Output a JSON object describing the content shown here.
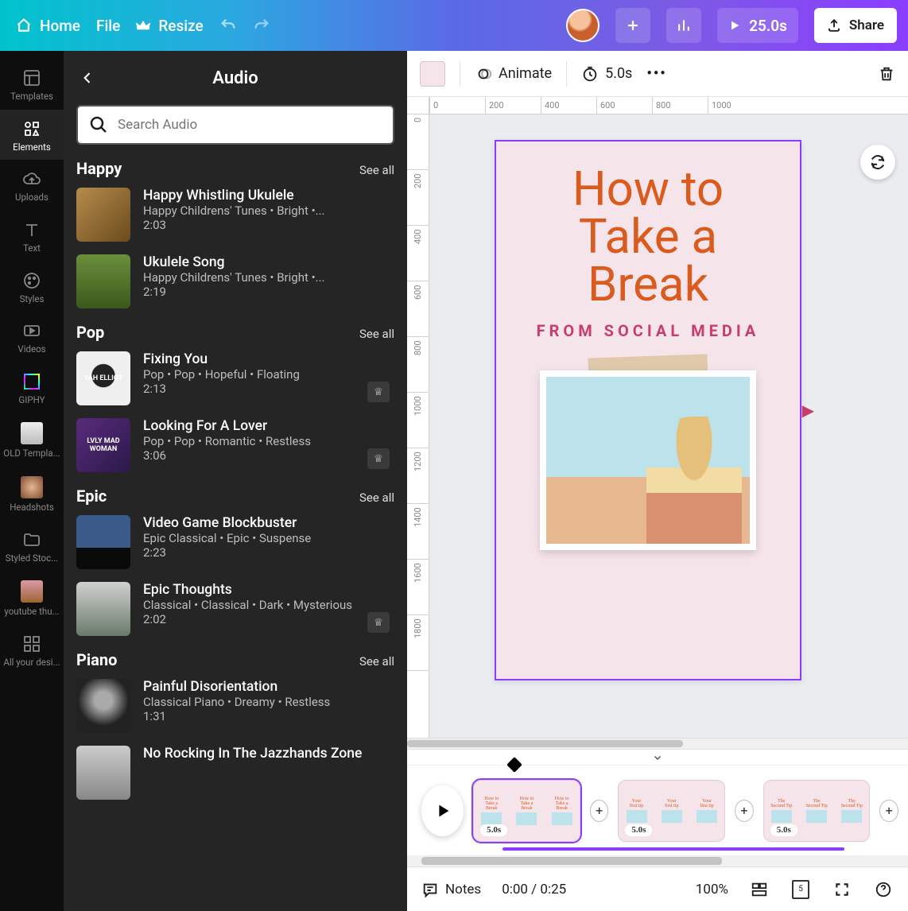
{
  "topbar": {
    "home": "Home",
    "file": "File",
    "resize": "Resize",
    "duration": "25.0s",
    "share": "Share"
  },
  "sidebar": {
    "items": [
      {
        "label": "Templates"
      },
      {
        "label": "Elements"
      },
      {
        "label": "Uploads"
      },
      {
        "label": "Text"
      },
      {
        "label": "Styles"
      },
      {
        "label": "Videos"
      },
      {
        "label": "GIPHY"
      },
      {
        "label": "OLD Templa..."
      },
      {
        "label": "Headshots"
      },
      {
        "label": "Styled Stoc..."
      },
      {
        "label": "youtube thu..."
      },
      {
        "label": "All your desi..."
      }
    ]
  },
  "panel": {
    "title": "Audio",
    "search_placeholder": "Search Audio",
    "sections": [
      {
        "name": "Happy",
        "see_all": "See all",
        "tracks": [
          {
            "title": "Happy Whistling Ukulele",
            "tags": "Happy Childrens' Tunes • Bright •...",
            "dur": "2:03",
            "art_bg": "linear-gradient(135deg,#b58c4a,#6b4a1e)"
          },
          {
            "title": "Ukulele Song",
            "tags": "Happy Childrens' Tunes • Bright •...",
            "dur": "2:19",
            "art_bg": "linear-gradient(180deg,#6a8f3a,#3a5a1e)"
          }
        ]
      },
      {
        "name": "Pop",
        "see_all": "See all",
        "tracks": [
          {
            "title": "Fixing You",
            "tags": "Pop • Pop • Hopeful • Floating",
            "dur": "2:13",
            "crown": true,
            "art_bg": "radial-gradient(circle at 50% 45%, #222 0 28%, #efefef 30% 100%)",
            "art_text": "YAH ELLIOT"
          },
          {
            "title": "Looking For A Lover",
            "tags": "Pop • Pop • Romantic • Restless",
            "dur": "3:06",
            "crown": true,
            "art_bg": "linear-gradient(135deg,#5a2a7a,#2a1a4a)",
            "art_text": "LVLY MAD WOMAN"
          }
        ]
      },
      {
        "name": "Epic",
        "see_all": "See all",
        "tracks": [
          {
            "title": "Video Game Blockbuster",
            "tags": "Epic Classical • Epic • Suspense",
            "dur": "2:23",
            "art_bg": "linear-gradient(180deg,#3a5a8a 0 60%,#0a0a0a 60% 100%)"
          },
          {
            "title": "Epic Thoughts",
            "tags": "Classical • Classical • Dark • Mysterious",
            "dur": "2:02",
            "crown": true,
            "art_bg": "linear-gradient(180deg,#d0d0d0,#6a7a6a)"
          }
        ]
      },
      {
        "name": "Piano",
        "see_all": "See all",
        "tracks": [
          {
            "title": "Painful Disorientation",
            "tags": "Classical Piano • Dreamy • Restless",
            "dur": "1:31",
            "art_bg": "radial-gradient(circle at 50% 40%, #aaa 0 20%, #222 60%)"
          },
          {
            "title": "No Rocking In The Jazzhands Zone",
            "tags": "",
            "dur": "",
            "art_bg": "linear-gradient(180deg,#ccc,#888)"
          }
        ]
      }
    ]
  },
  "toolrow": {
    "animate": "Animate",
    "page_dur": "5.0s"
  },
  "ruler_top": [
    "0",
    "200",
    "400",
    "600",
    "800",
    "1000"
  ],
  "ruler_left": [
    "0",
    "200",
    "400",
    "600",
    "800",
    "1000",
    "1200",
    "1400",
    "1600",
    "1800"
  ],
  "stage": {
    "title_lines": [
      "How to",
      "Take a",
      "Break"
    ],
    "subtitle": "FROM SOCIAL MEDIA"
  },
  "timeline": {
    "scenes": [
      {
        "badge": "5.0s",
        "selected": true,
        "lines": [
          "How to",
          "Take a",
          "Break"
        ]
      },
      {
        "badge": "5.0s",
        "selected": false,
        "lines": [
          "Your",
          "first tip"
        ]
      },
      {
        "badge": "5.0s",
        "selected": false,
        "lines": [
          "The",
          "Second Tip"
        ]
      }
    ]
  },
  "bottombar": {
    "notes": "Notes",
    "time": "0:00 / 0:25",
    "zoom": "100%",
    "page_count": "5"
  }
}
